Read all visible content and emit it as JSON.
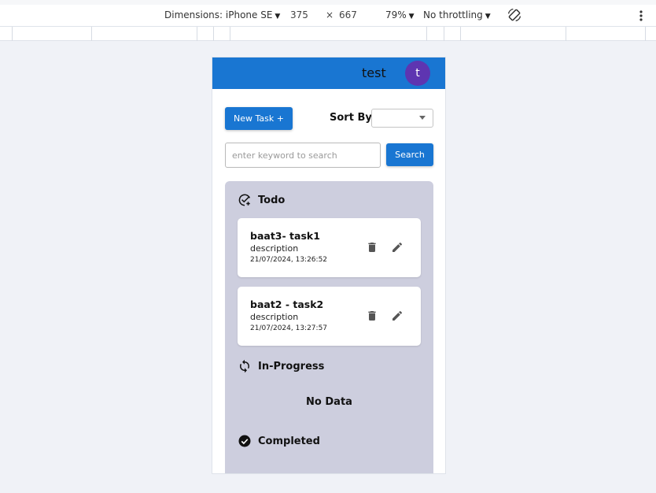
{
  "devtools": {
    "dimensions_label": "Dimensions: iPhone SE",
    "width": "375",
    "times": "×",
    "height": "667",
    "zoom": "79%",
    "throttling": "No throttling"
  },
  "app": {
    "username": "test",
    "avatar_letter": "t",
    "new_task_label": "New Task +",
    "sort_by_label": "Sort By",
    "sort_value": "",
    "search_placeholder": "enter keyword to search",
    "search_value": "",
    "search_button_label": "Search",
    "sections": {
      "todo": "Todo",
      "in_progress": "In-Progress",
      "completed": "Completed"
    },
    "tasks": [
      {
        "title": "baat3- task1",
        "description": "description",
        "timestamp": "21/07/2024, 13:26:52"
      },
      {
        "title": "baat2 - task2",
        "description": "description",
        "timestamp": "21/07/2024, 13:27:57"
      }
    ],
    "in_progress_empty": "No Data"
  },
  "colors": {
    "appbar": "#1976d2",
    "avatar": "#5e35b1",
    "board": "#cdcede"
  },
  "icons": {
    "todo": "add-task-icon",
    "in_progress": "sync-icon",
    "completed": "check-circle-icon",
    "delete": "trash-icon",
    "edit": "pencil-icon"
  }
}
